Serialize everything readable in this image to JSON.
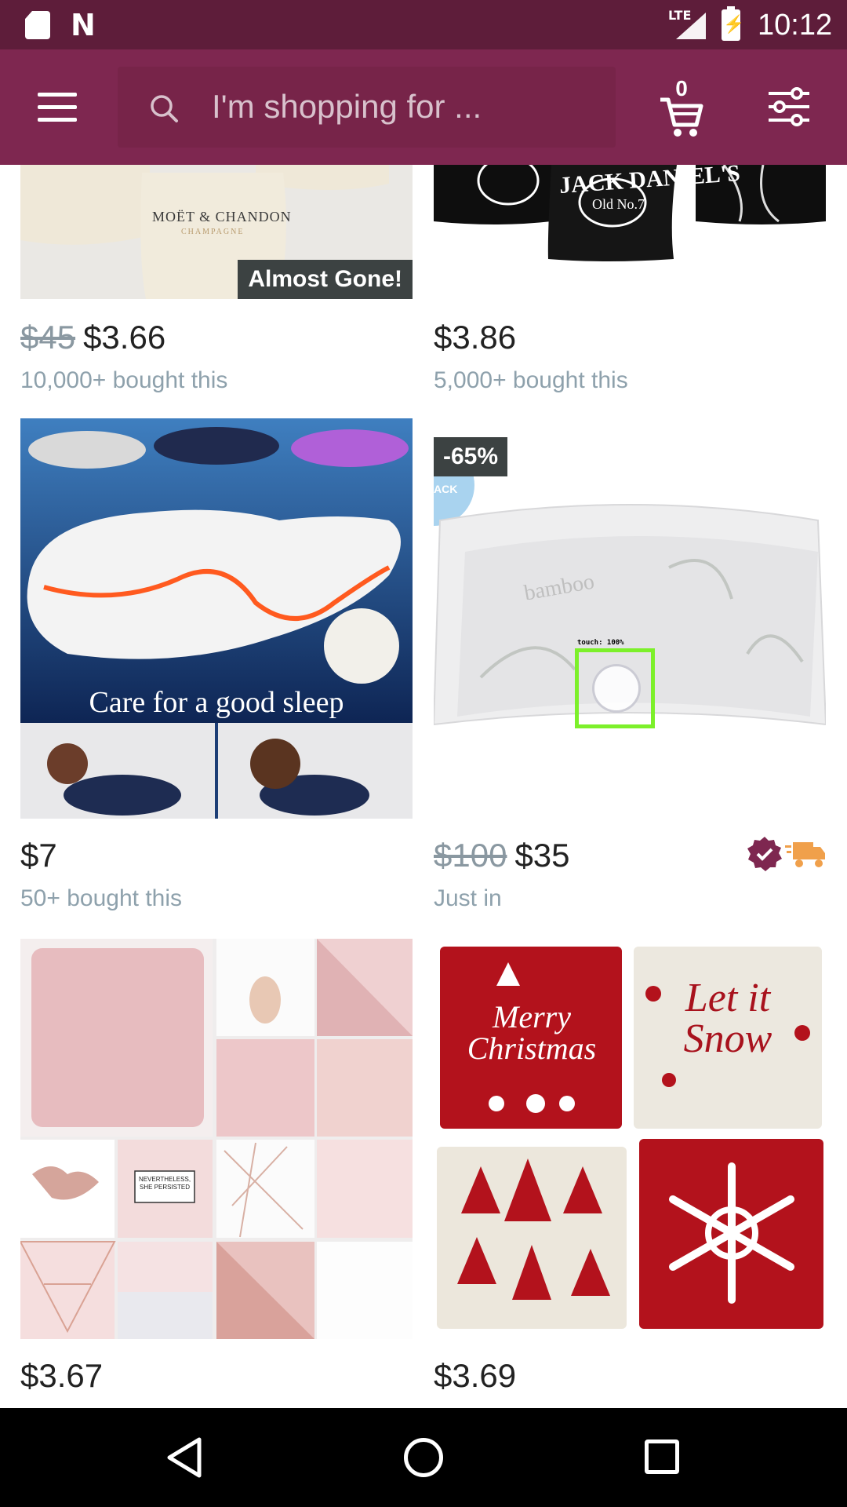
{
  "status_bar": {
    "network": "LTE",
    "time": "10:12"
  },
  "header": {
    "search_placeholder": "I'm shopping for ...",
    "cart_count": "0"
  },
  "products": [
    {
      "image_text": "MOËT & CHANDON",
      "image_subtext": "CHAMPAGNE",
      "badge": "Almost Gone!",
      "old_price": "$45",
      "price": "$3.66",
      "subtitle": "10,000+ bought this"
    },
    {
      "image_text": "JACK DANIEL'S",
      "image_subtext": "Old No.7",
      "price": "$3.86",
      "subtitle": "5,000+ bought this"
    },
    {
      "image_text": "Care for a good sleep",
      "price": "$7",
      "subtitle": "50+ bought this"
    },
    {
      "badge": "-65%",
      "corner_text": "ACK",
      "image_text": "bamboo",
      "old_price": "$100",
      "price": "$35",
      "subtitle": "Just in",
      "icons": [
        "verified-badge-icon",
        "fast-shipping-truck-icon"
      ]
    },
    {
      "image_text": "NEVERTHELESS, SHE PERSISTED",
      "price": "$3.67"
    },
    {
      "image_texts": [
        "Merry Christmas",
        "Let it Snow"
      ],
      "price": "$3.69"
    }
  ],
  "touch_indicator": {
    "label": "touch: 100%"
  },
  "colors": {
    "status_bar": "#5e1d3a",
    "app_bar": "#7e2750",
    "badge_bg": "#3c4242",
    "verified_badge": "#7e2750",
    "truck": "#f0a04b",
    "touch_box": "#7cf02a"
  }
}
